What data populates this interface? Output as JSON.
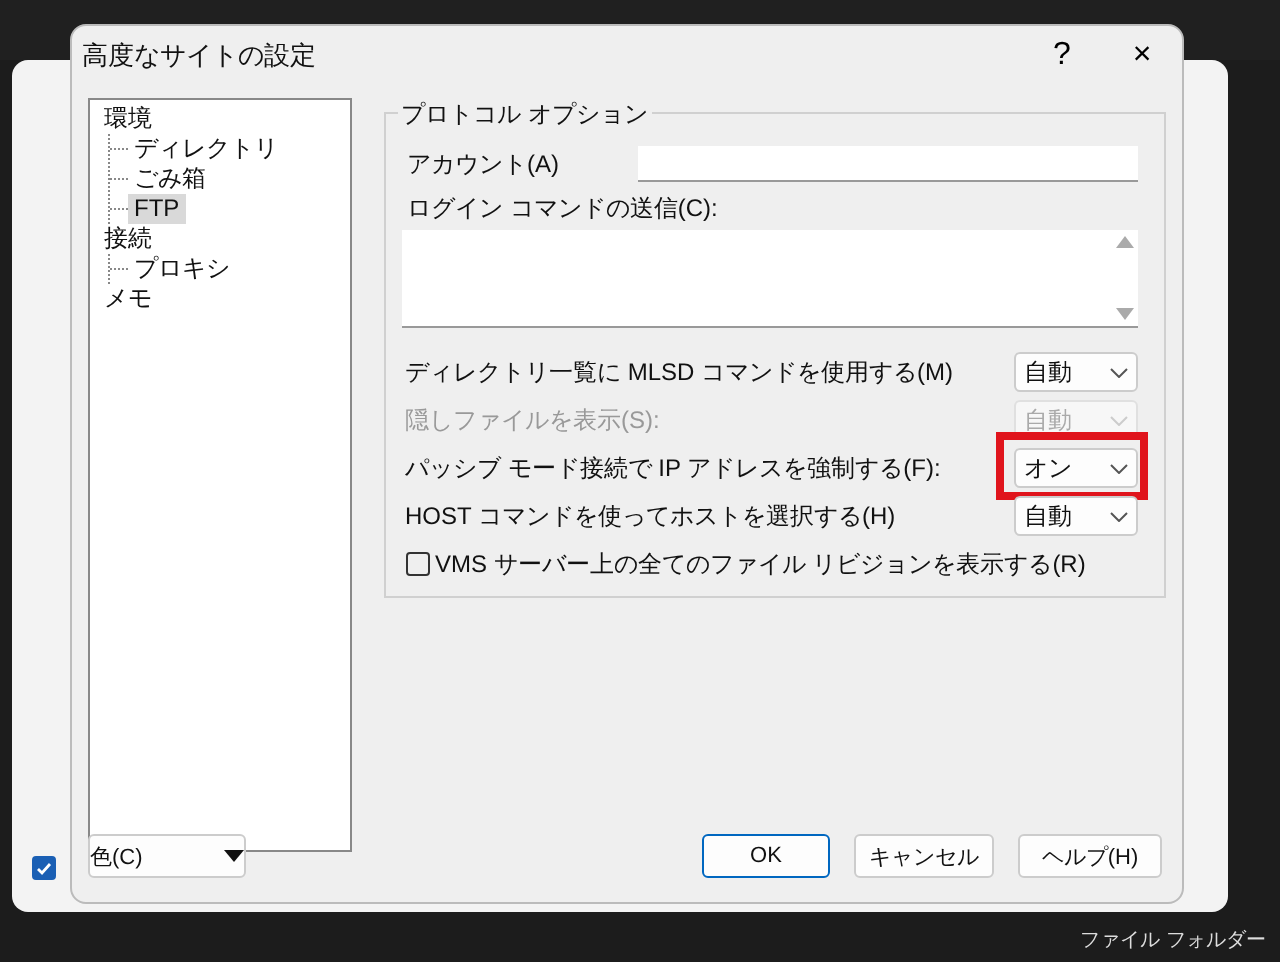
{
  "background": {
    "checked": true,
    "file_type": "ファイル フォルダー"
  },
  "window": {
    "title": "高度なサイトの設定",
    "help": "?",
    "close": "×"
  },
  "sidebar": {
    "items": [
      {
        "label": "環境",
        "selected": false,
        "children": [
          {
            "label": "ディレクトリ",
            "selected": false
          },
          {
            "label": "ごみ箱",
            "selected": false
          },
          {
            "label": "FTP",
            "selected": true
          }
        ]
      },
      {
        "label": "接続",
        "selected": false,
        "children": [
          {
            "label": "プロキシ",
            "selected": false
          }
        ]
      },
      {
        "label": "メモ",
        "selected": false
      }
    ]
  },
  "group": {
    "title": "プロトコル オプション",
    "account_label": "アカウント(A)",
    "login_label": "ログイン コマンドの送信(C):",
    "options": [
      {
        "kind": "select",
        "label": "ディレクトリ一覧に MLSD コマンドを使用する(M)",
        "value": "自動",
        "disabled": false,
        "highlighted": false
      },
      {
        "kind": "select",
        "label": "隠しファイルを表示(S):",
        "value": "自動",
        "disabled": true,
        "highlighted": false
      },
      {
        "kind": "select",
        "label": "パッシブ モード接続で IP アドレスを強制する(F):",
        "value": "オン",
        "disabled": false,
        "highlighted": true
      },
      {
        "kind": "select",
        "label": "HOST コマンドを使ってホストを選択する(H)",
        "value": "自動",
        "disabled": false,
        "highlighted": false
      },
      {
        "kind": "checkbox",
        "label": "VMS サーバー上の全てのファイル リビジョンを表示する(R)",
        "checked": false
      }
    ]
  },
  "footer": {
    "color_button": "色(C)",
    "buttons": [
      "OK",
      "キャンセル",
      "ヘルプ(H)"
    ]
  }
}
